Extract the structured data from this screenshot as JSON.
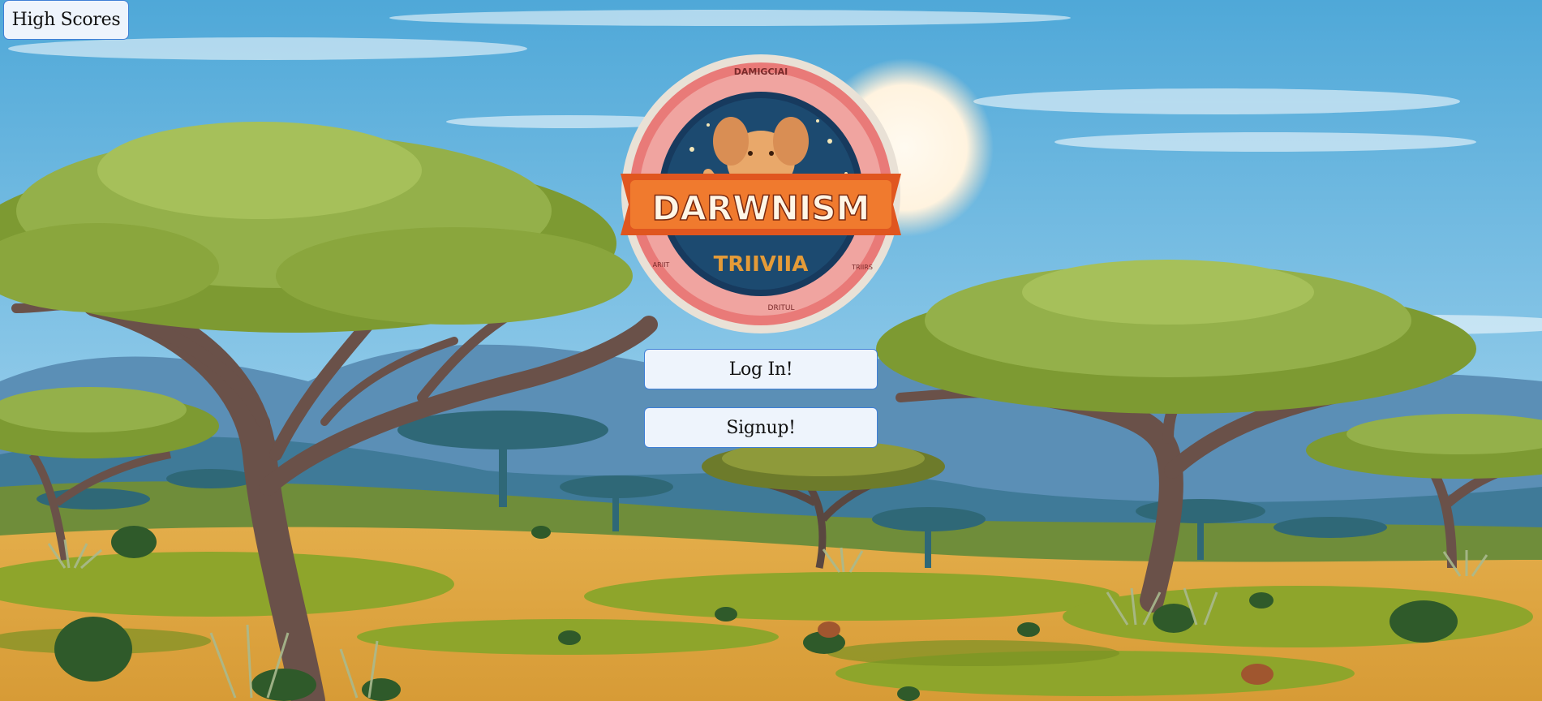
{
  "header": {
    "high_scores_label": "High Scores"
  },
  "logo": {
    "top_arc_text": "DAMIGCIAI",
    "title": "DARWNISM",
    "subtitle": "TRIIVIIA",
    "left_small": "ARIIT",
    "right_small": "TRIIRS",
    "bottom_arc_text": "DRITUL"
  },
  "auth": {
    "login_label": "Log In!",
    "signup_label": "Signup!"
  },
  "colors": {
    "sky_top": "#4fa8d8",
    "sky_bottom": "#cfe9f6",
    "savanna": "#d9a441",
    "grass": "#8ea52b",
    "button_bg": "#eef4fc",
    "button_border": "#3f7fd6",
    "logo_ring": "#e97a78",
    "logo_banner": "#e0561f",
    "logo_center": "#173a5e"
  }
}
